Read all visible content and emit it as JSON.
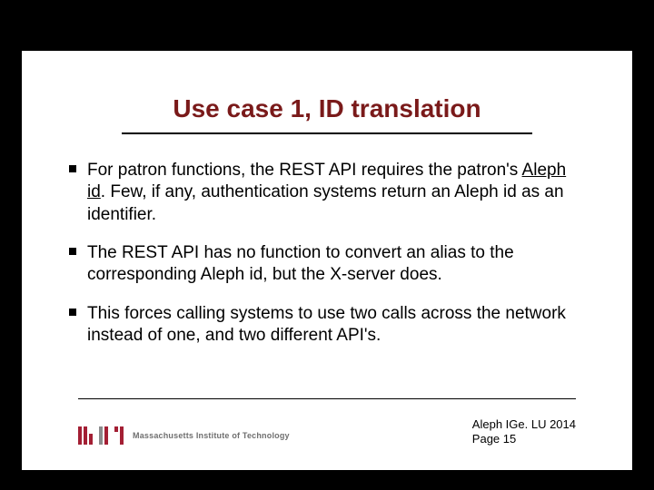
{
  "title": "Use case 1, ID translation",
  "bullets": [
    {
      "pre": "For patron functions, the REST API requires the patron's ",
      "underlined": "Aleph id",
      "post": ". Few, if any, authentication systems return an Aleph id as an identifier."
    },
    {
      "pre": "The REST API has no function to convert an alias to the corresponding Aleph id, but the X-server does.",
      "underlined": "",
      "post": ""
    },
    {
      "pre": "This forces calling systems to use two calls across the network instead of one, and two different API's.",
      "underlined": "",
      "post": ""
    }
  ],
  "logo_text": "Massachusetts Institute of Technology",
  "footer": {
    "line1": "Aleph  IGe. LU 2014",
    "line2": "Page 15"
  }
}
